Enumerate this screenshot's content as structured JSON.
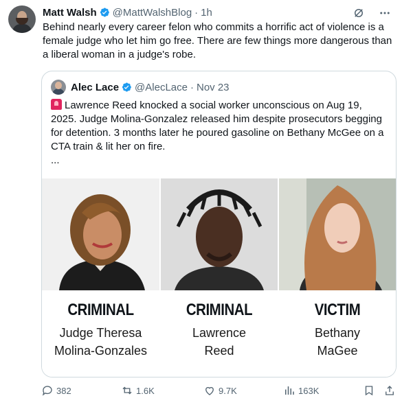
{
  "tweet": {
    "author_name": "Matt Walsh",
    "author_handle": "@MattWalshBlog",
    "time": "1h",
    "text": "Behind nearly every career felon who commits a horrific act of violence is a female judge who let him go free. There are few things more dangerous than a liberal woman in a judge's robe."
  },
  "quote": {
    "author_name": "Alec Lace",
    "author_handle": "@AlecLace",
    "date": "Nov 23",
    "text": "Lawrence Reed knocked a social worker unconscious on Aug 19, 2025. Judge Molina-Gonzalez released him despite prosecutors begging for detention. 3 months later he poured gasoline on Bethany McGee on a CTA train & lit her on fire.",
    "ellipsis": "...",
    "captions": [
      {
        "title": "CRIMINAL",
        "line1": "Judge Theresa",
        "line2": "Molina-Gonzales"
      },
      {
        "title": "CRIMINAL",
        "line1": "Lawrence",
        "line2": "Reed"
      },
      {
        "title": "VICTIM",
        "line1": "Bethany",
        "line2": "MaGee"
      }
    ]
  },
  "actions": {
    "replies": "382",
    "reposts": "1.6K",
    "likes": "9.7K",
    "views": "163K"
  },
  "colors": {
    "verified": "#1d9bf0",
    "muted": "#536471",
    "border": "#cfd9de"
  }
}
